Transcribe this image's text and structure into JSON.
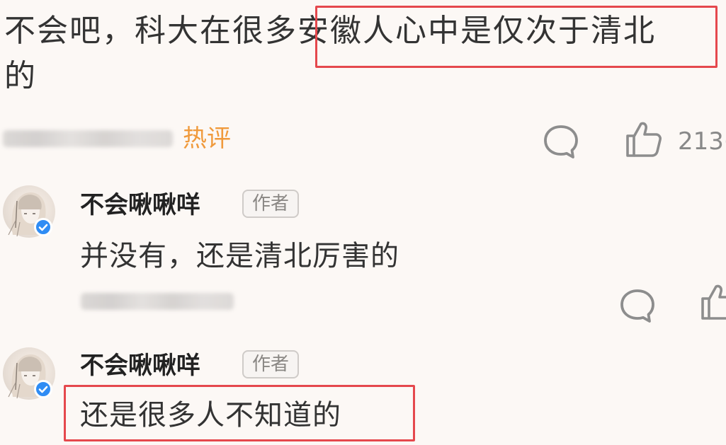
{
  "main_comment": {
    "text_line1": "不会吧，科大在很多安徽人心中是仅次于清北",
    "text_line2": "的",
    "hot_tag": "热评",
    "like_count": "213("
  },
  "replies": [
    {
      "username": "不会啾啾咩",
      "badge": "作者",
      "text": "并没有，还是清北厉害的"
    },
    {
      "username": "不会啾啾咩",
      "badge": "作者",
      "text": "还是很多人不知道的"
    }
  ],
  "icons": {
    "comment": "comment-bubble-icon",
    "like": "thumbs-up-icon",
    "verified": "verified-check-icon"
  },
  "colors": {
    "background": "#fcf8f5",
    "hot_tag": "#f09a3c",
    "highlight_box": "#e5484d",
    "verified": "#2f8cf4"
  }
}
